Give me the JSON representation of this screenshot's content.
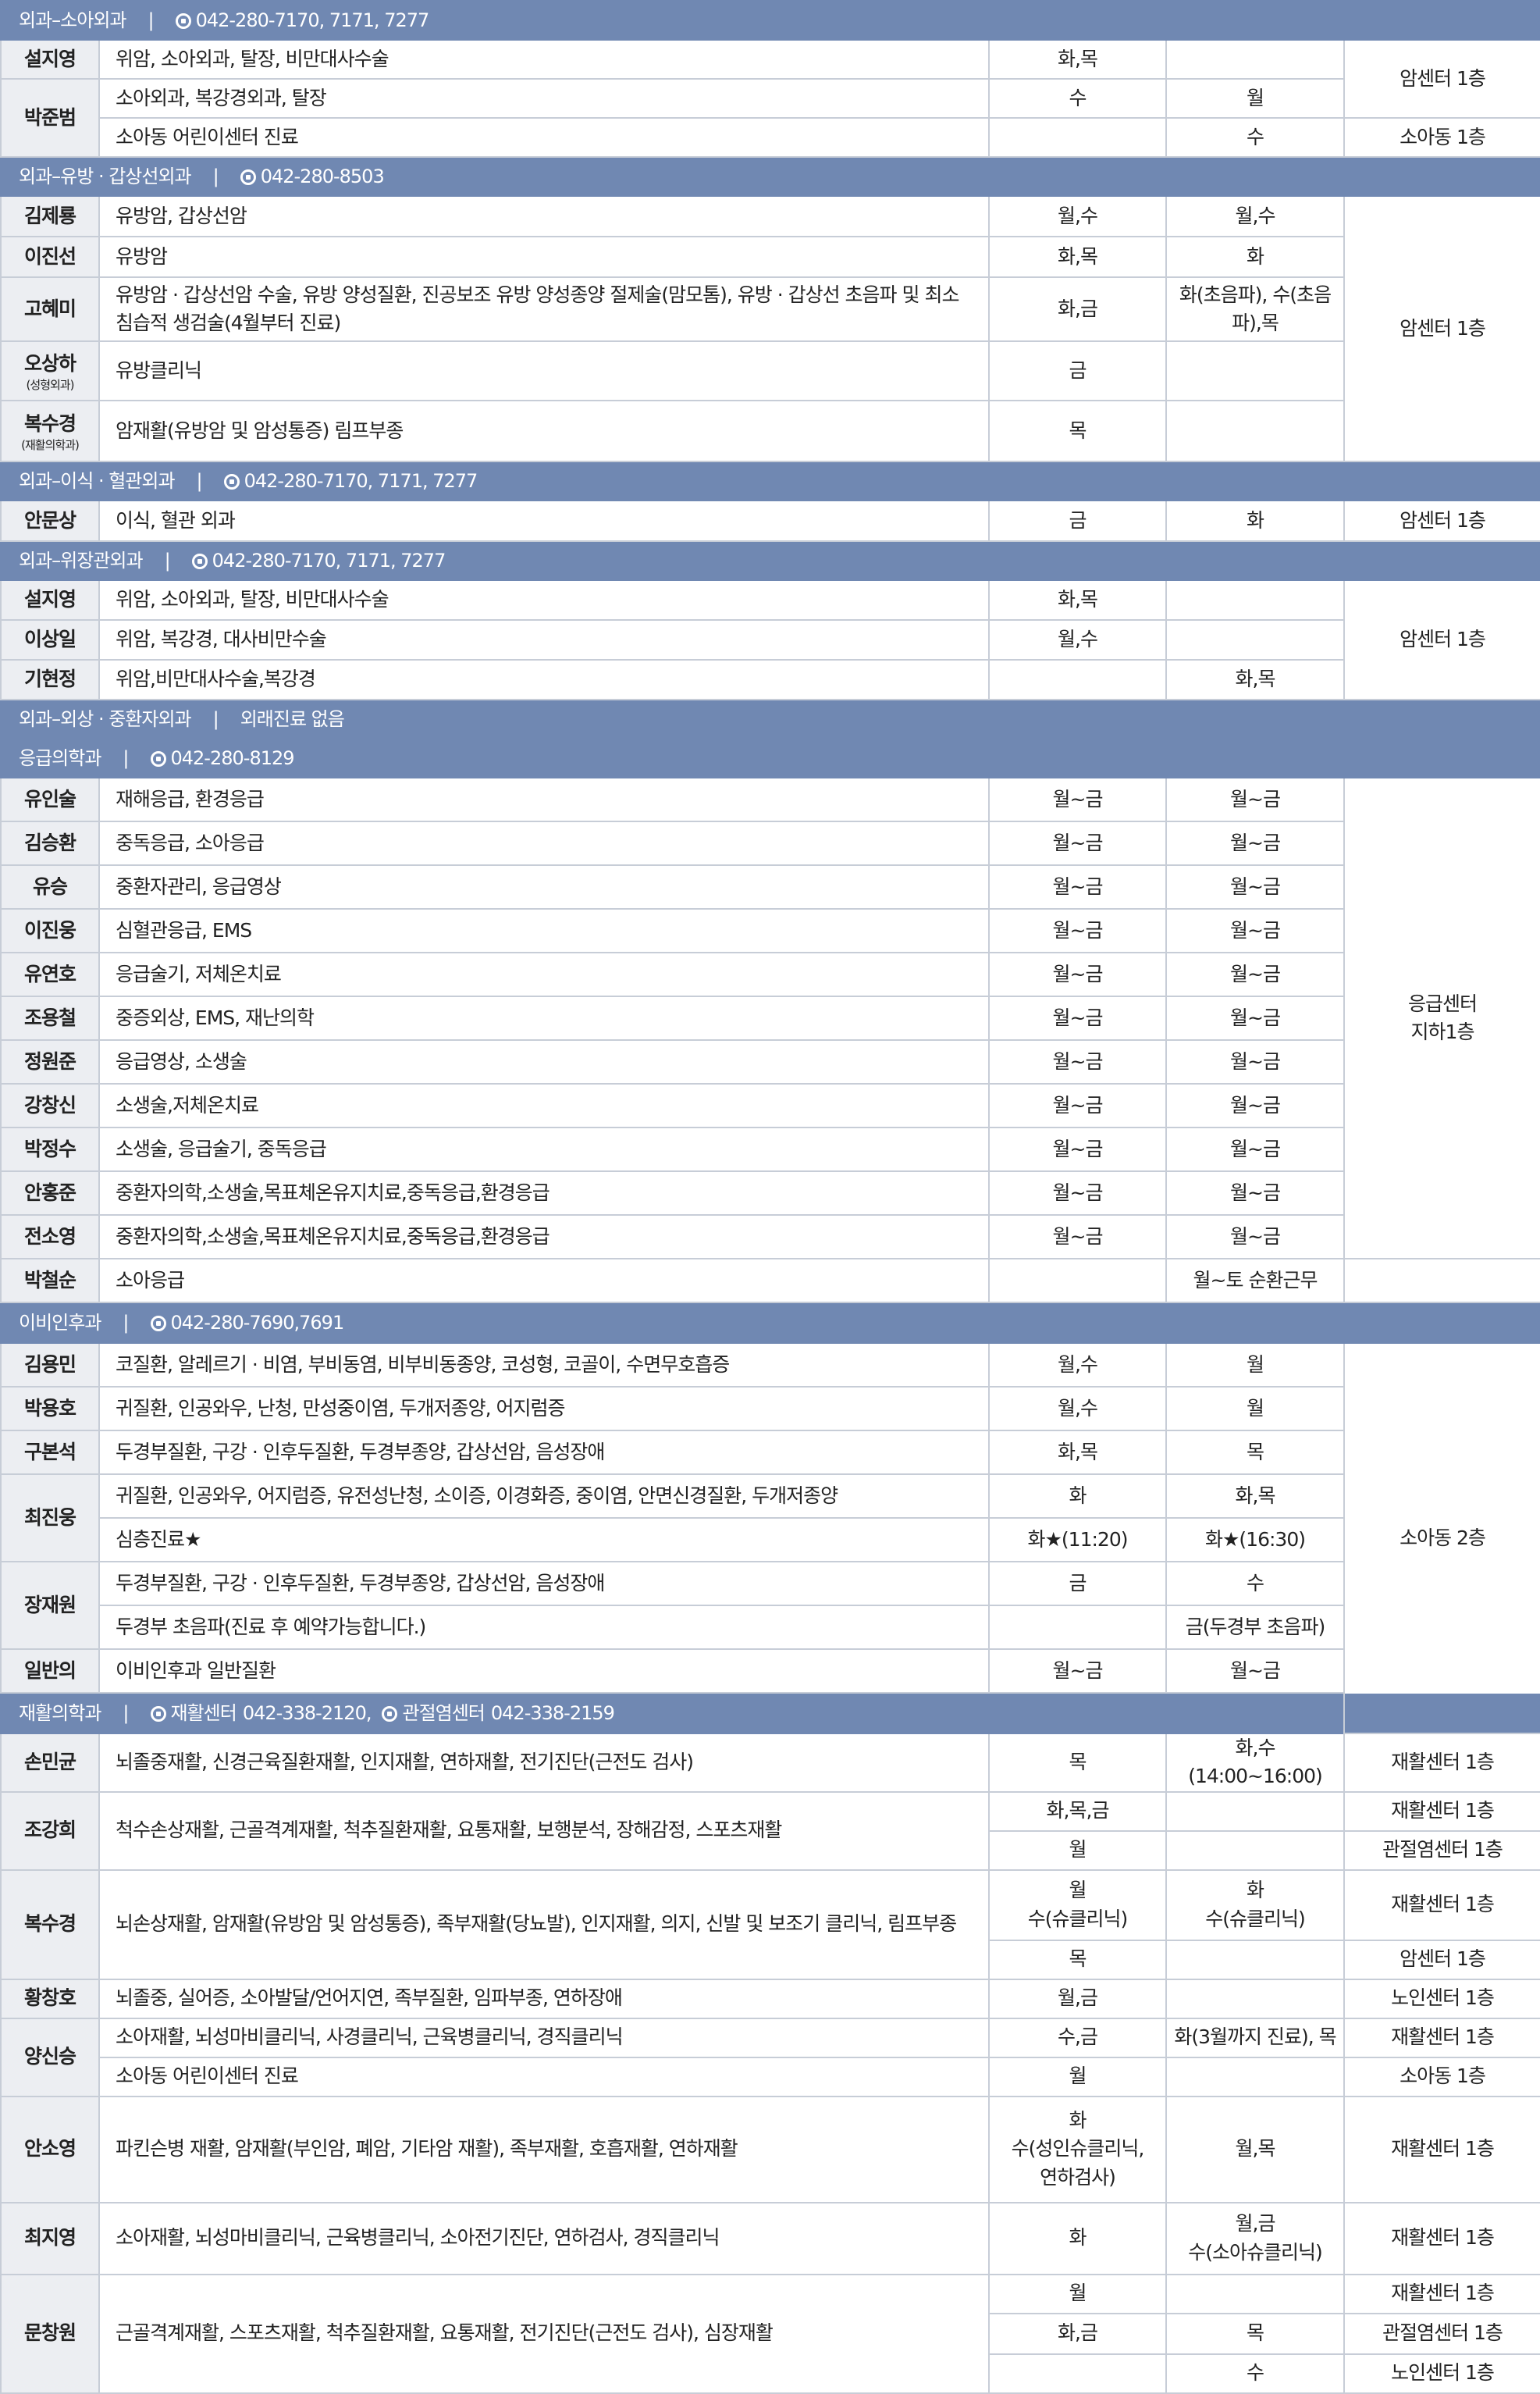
{
  "sections": [
    {
      "header": {
        "dept": "외과–소아외과",
        "contacts": [
          {
            "label": "",
            "phone": "042-280-7170, 7171, 7277"
          }
        ]
      },
      "rows": [
        [
          {
            "t": "nm",
            "v": "설지영",
            "h": 50
          },
          {
            "t": "desc",
            "v": "위암, 소아외과, 탈장, 비만대사수술"
          },
          {
            "t": "am",
            "v": "화,목"
          },
          {
            "t": "pm",
            "v": ""
          },
          {
            "t": "loc",
            "v": "암센터 1층",
            "rs": 2
          }
        ],
        [
          {
            "t": "nm",
            "v": "박준범",
            "rs": 2,
            "h": 50
          },
          {
            "t": "desc",
            "v": "소아외과, 복강경외과, 탈장"
          },
          {
            "t": "am",
            "v": "수"
          },
          {
            "t": "pm",
            "v": "월"
          }
        ],
        [
          {
            "t": "desc",
            "v": "소아동 어린이센터 진료",
            "h": 50
          },
          {
            "t": "am",
            "v": ""
          },
          {
            "t": "pm",
            "v": "수"
          },
          {
            "t": "loc",
            "v": "소아동 1층"
          }
        ]
      ]
    },
    {
      "header": {
        "dept": "외과–유방 · 갑상선외과",
        "contacts": [
          {
            "label": "",
            "phone": "042-280-8503"
          }
        ]
      },
      "rows": [
        [
          {
            "t": "nm",
            "v": "김제룡",
            "h": 52
          },
          {
            "t": "desc",
            "v": "유방암, 갑상선암"
          },
          {
            "t": "am",
            "v": "월,수"
          },
          {
            "t": "pm",
            "v": "월,수"
          },
          {
            "t": "loc",
            "v": "암센터 1층",
            "rs": 5
          }
        ],
        [
          {
            "t": "nm",
            "v": "이진선",
            "h": 52
          },
          {
            "t": "desc",
            "v": "유방암"
          },
          {
            "t": "am",
            "v": "화,목"
          },
          {
            "t": "pm",
            "v": "화"
          }
        ],
        [
          {
            "t": "nm",
            "v": "고혜미",
            "h": 82
          },
          {
            "t": "desc",
            "v": "유방암 · 갑상선암 수술, 유방 양성질환, 진공보조 유방 양성종양 절제술(맘모톰), 유방 · 갑상선 초음파 및 최소 침습적 생검술(4월부터 진료)"
          },
          {
            "t": "am",
            "v": "화,금"
          },
          {
            "t": "pm",
            "v": "화(초음파), 수(초음파),목"
          }
        ],
        [
          {
            "t": "nm",
            "v": "오상하",
            "sub": "(성형외과)",
            "h": 76
          },
          {
            "t": "desc",
            "v": "유방클리닉"
          },
          {
            "t": "am",
            "v": "금"
          },
          {
            "t": "pm",
            "v": ""
          }
        ],
        [
          {
            "t": "nm",
            "v": "복수경",
            "sub": "(재활의학과)",
            "h": 78
          },
          {
            "t": "desc",
            "v": "암재활(유방암 및 암성통증) 림프부종"
          },
          {
            "t": "am",
            "v": "목"
          },
          {
            "t": "pm",
            "v": ""
          }
        ]
      ]
    },
    {
      "header": {
        "dept": "외과–이식 · 혈관외과",
        "contacts": [
          {
            "label": "",
            "phone": "042-280-7170, 7171, 7277"
          }
        ]
      },
      "rows": [
        [
          {
            "t": "nm",
            "v": "안문상",
            "h": 52
          },
          {
            "t": "desc",
            "v": "이식, 혈관 외과"
          },
          {
            "t": "am",
            "v": "금"
          },
          {
            "t": "pm",
            "v": "화"
          },
          {
            "t": "loc",
            "v": "암센터 1층"
          }
        ]
      ]
    },
    {
      "header": {
        "dept": "외과–위장관외과",
        "contacts": [
          {
            "label": "",
            "phone": "042-280-7170, 7171, 7277"
          }
        ]
      },
      "rows": [
        [
          {
            "t": "nm",
            "v": "설지영",
            "h": 51
          },
          {
            "t": "desc",
            "v": "위암, 소아외과, 탈장, 비만대사수술"
          },
          {
            "t": "am",
            "v": "화,목"
          },
          {
            "t": "pm",
            "v": ""
          },
          {
            "t": "loc",
            "v": "암센터 1층",
            "rs": 3
          }
        ],
        [
          {
            "t": "nm",
            "v": "이상일",
            "h": 51
          },
          {
            "t": "desc",
            "v": "위암, 복강경, 대사비만수술"
          },
          {
            "t": "am",
            "v": "월,수"
          },
          {
            "t": "pm",
            "v": ""
          }
        ],
        [
          {
            "t": "nm",
            "v": "기현정",
            "h": 51
          },
          {
            "t": "desc",
            "v": "위암,비만대사수술,복강경"
          },
          {
            "t": "am",
            "v": ""
          },
          {
            "t": "pm",
            "v": "화,목"
          }
        ]
      ]
    },
    {
      "header": {
        "dept": "외과–외상 · 중환자외과",
        "contacts": [],
        "note": "외래진료 없음"
      },
      "rows": []
    },
    {
      "header": {
        "dept": "응급의학과",
        "contacts": [
          {
            "label": "",
            "phone": "042-280-8129"
          }
        ]
      },
      "rows": [
        [
          {
            "t": "nm",
            "v": "유인술",
            "h": 56
          },
          {
            "t": "desc",
            "v": "재해응급, 환경응급"
          },
          {
            "t": "am",
            "v": "월~금"
          },
          {
            "t": "pm",
            "v": "월~금"
          },
          {
            "t": "loc",
            "v": "응급센터\n지하1층",
            "rs": 11
          }
        ],
        [
          {
            "t": "nm",
            "v": "김승환",
            "h": 56
          },
          {
            "t": "desc",
            "v": "중독응급, 소아응급"
          },
          {
            "t": "am",
            "v": "월~금"
          },
          {
            "t": "pm",
            "v": "월~금"
          }
        ],
        [
          {
            "t": "nm",
            "v": "유승",
            "h": 56
          },
          {
            "t": "desc",
            "v": "중환자관리, 응급영상"
          },
          {
            "t": "am",
            "v": "월~금"
          },
          {
            "t": "pm",
            "v": "월~금"
          }
        ],
        [
          {
            "t": "nm",
            "v": "이진웅",
            "h": 56
          },
          {
            "t": "desc",
            "v": "심혈관응급, EMS"
          },
          {
            "t": "am",
            "v": "월~금"
          },
          {
            "t": "pm",
            "v": "월~금"
          }
        ],
        [
          {
            "t": "nm",
            "v": "유연호",
            "h": 56
          },
          {
            "t": "desc",
            "v": "응급술기, 저체온치료"
          },
          {
            "t": "am",
            "v": "월~금"
          },
          {
            "t": "pm",
            "v": "월~금"
          }
        ],
        [
          {
            "t": "nm",
            "v": "조용철",
            "h": 56
          },
          {
            "t": "desc",
            "v": "중증외상, EMS, 재난의학"
          },
          {
            "t": "am",
            "v": "월~금"
          },
          {
            "t": "pm",
            "v": "월~금"
          }
        ],
        [
          {
            "t": "nm",
            "v": "정원준",
            "h": 56
          },
          {
            "t": "desc",
            "v": "응급영상, 소생술"
          },
          {
            "t": "am",
            "v": "월~금"
          },
          {
            "t": "pm",
            "v": "월~금"
          }
        ],
        [
          {
            "t": "nm",
            "v": "강창신",
            "h": 56
          },
          {
            "t": "desc",
            "v": "소생술,저체온치료"
          },
          {
            "t": "am",
            "v": "월~금"
          },
          {
            "t": "pm",
            "v": "월~금"
          }
        ],
        [
          {
            "t": "nm",
            "v": "박정수",
            "h": 56
          },
          {
            "t": "desc",
            "v": "소생술, 응급술기, 중독응급"
          },
          {
            "t": "am",
            "v": "월~금"
          },
          {
            "t": "pm",
            "v": "월~금"
          }
        ],
        [
          {
            "t": "nm",
            "v": "안홍준",
            "h": 56
          },
          {
            "t": "desc",
            "v": "중환자의학,소생술,목표체온유지치료,중독응급,환경응급"
          },
          {
            "t": "am",
            "v": "월~금"
          },
          {
            "t": "pm",
            "v": "월~금"
          }
        ],
        [
          {
            "t": "nm",
            "v": "전소영",
            "h": 56
          },
          {
            "t": "desc",
            "v": "중환자의학,소생술,목표체온유지치료,중독응급,환경응급"
          },
          {
            "t": "am",
            "v": "월~금"
          },
          {
            "t": "pm",
            "v": "월~금"
          }
        ],
        [
          {
            "t": "nm",
            "v": "박철순",
            "h": 56
          },
          {
            "t": "desc",
            "v": "소아응급"
          },
          {
            "t": "am",
            "v": ""
          },
          {
            "t": "pm",
            "v": "월~토 순환근무"
          },
          {
            "t": "loc",
            "v": ""
          }
        ]
      ]
    },
    {
      "header": {
        "dept": "이비인후과",
        "contacts": [
          {
            "label": "",
            "phone": "042-280-7690,7691"
          }
        ]
      },
      "rows": [
        [
          {
            "t": "nm",
            "v": "김용민",
            "h": 56
          },
          {
            "t": "desc",
            "v": "코질환, 알레르기 · 비염, 부비동염, 비부비동종양, 코성형, 코골이, 수면무호흡증"
          },
          {
            "t": "am",
            "v": "월,수"
          },
          {
            "t": "pm",
            "v": "월"
          },
          {
            "t": "loc",
            "v": "소아동 2층",
            "rs": 9
          }
        ],
        [
          {
            "t": "nm",
            "v": "박용호",
            "h": 56
          },
          {
            "t": "desc",
            "v": "귀질환, 인공와우, 난청, 만성중이염, 두개저종양, 어지럼증"
          },
          {
            "t": "am",
            "v": "월,수"
          },
          {
            "t": "pm",
            "v": "월"
          }
        ],
        [
          {
            "t": "nm",
            "v": "구본석",
            "h": 56
          },
          {
            "t": "desc",
            "v": "두경부질환, 구강 · 인후두질환, 두경부종양, 갑상선암, 음성장애"
          },
          {
            "t": "am",
            "v": "화,목"
          },
          {
            "t": "pm",
            "v": "목"
          }
        ],
        [
          {
            "t": "nm",
            "v": "최진웅",
            "rs": 2,
            "h": 56
          },
          {
            "t": "desc",
            "v": "귀질환, 인공와우, 어지럼증, 유전성난청, 소이증, 이경화증, 중이염, 안면신경질환, 두개저종양"
          },
          {
            "t": "am",
            "v": "화"
          },
          {
            "t": "pm",
            "v": "화,목"
          }
        ],
        [
          {
            "t": "desc",
            "v": "심층진료★",
            "h": 56
          },
          {
            "t": "am",
            "v": "화★(11:20)"
          },
          {
            "t": "pm",
            "v": "화★(16:30)"
          }
        ],
        [
          {
            "t": "nm",
            "v": "장재원",
            "rs": 2,
            "h": 56
          },
          {
            "t": "desc",
            "v": "두경부질환, 구강 · 인후두질환, 두경부종양, 갑상선암, 음성장애"
          },
          {
            "t": "am",
            "v": "금"
          },
          {
            "t": "pm",
            "v": "수"
          }
        ],
        [
          {
            "t": "desc",
            "v": "두경부 초음파(진료 후 예약가능합니다.)",
            "h": 56
          },
          {
            "t": "am",
            "v": ""
          },
          {
            "t": "pm",
            "v": "금(두경부 초음파)"
          }
        ],
        [
          {
            "t": "nm",
            "v": "일반의",
            "h": 56
          },
          {
            "t": "desc",
            "v": "이비인후과 일반질환"
          },
          {
            "t": "am",
            "v": "월~금"
          },
          {
            "t": "pm",
            "v": "월~금"
          }
        ]
      ]
    },
    {
      "header": {
        "dept": "재활의학과",
        "contacts": [
          {
            "label": "재활센터",
            "phone": "042-338-2120,"
          },
          {
            "label": "관절염센터",
            "phone": "042-338-2159"
          }
        ]
      },
      "rows": [
        [
          {
            "t": "nm",
            "v": "손민균",
            "h": 52
          },
          {
            "t": "desc",
            "v": "뇌졸중재활, 신경근육질환재활, 인지재활, 연하재활, 전기진단(근전도 검사)"
          },
          {
            "t": "am",
            "v": "목"
          },
          {
            "t": "pm",
            "v": "화,수(14:00~16:00)"
          },
          {
            "t": "loc",
            "v": "재활센터 1층"
          }
        ],
        [
          {
            "t": "nm",
            "v": "조강희",
            "rs": 2,
            "h": 50
          },
          {
            "t": "desc",
            "v": "척수손상재활, 근골격계재활, 척추질환재활, 요통재활, 보행분석, 장해감정, 스포츠재활",
            "rs": 2
          },
          {
            "t": "am",
            "v": "화,목,금"
          },
          {
            "t": "pm",
            "v": ""
          },
          {
            "t": "loc",
            "v": "재활센터 1층"
          }
        ],
        [
          {
            "h": 50
          },
          {
            "t": "am",
            "v": "월"
          },
          {
            "t": "pm",
            "v": ""
          },
          {
            "t": "loc",
            "v": "관절염센터 1층"
          }
        ],
        [
          {
            "t": "nm",
            "v": "복수경",
            "rs": 2,
            "h": 90
          },
          {
            "t": "desc",
            "v": "뇌손상재활, 암재활(유방암 및 암성통증), 족부재활(당뇨발), 인지재활, 의지, 신발 및 보조기 클리닉, 림프부종",
            "rs": 2
          },
          {
            "t": "am",
            "v": "월\n수(슈클리닉)"
          },
          {
            "t": "pm",
            "v": "화\n수(슈클리닉)"
          },
          {
            "t": "loc",
            "v": "재활센터 1층"
          }
        ],
        [
          {
            "h": 50
          },
          {
            "t": "am",
            "v": "목"
          },
          {
            "t": "pm",
            "v": ""
          },
          {
            "t": "loc",
            "v": "암센터 1층"
          }
        ],
        [
          {
            "t": "nm",
            "v": "황창호",
            "h": 50
          },
          {
            "t": "desc",
            "v": "뇌졸중, 실어증, 소아발달/언어지연, 족부질환, 임파부종, 연하장애"
          },
          {
            "t": "am",
            "v": "월,금"
          },
          {
            "t": "pm",
            "v": ""
          },
          {
            "t": "loc",
            "v": "노인센터 1층"
          }
        ],
        [
          {
            "t": "nm",
            "v": "양신승",
            "rs": 2,
            "h": 50
          },
          {
            "t": "desc",
            "v": "소아재활, 뇌성마비클리닉, 사경클리닉, 근육병클리닉, 경직클리닉"
          },
          {
            "t": "am",
            "v": "수,금"
          },
          {
            "t": "pm",
            "v": "화(3월까지 진료), 목"
          },
          {
            "t": "loc",
            "v": "재활센터 1층"
          }
        ],
        [
          {
            "t": "desc",
            "v": "소아동 어린이센터 진료",
            "h": 50
          },
          {
            "t": "am",
            "v": "월"
          },
          {
            "t": "pm",
            "v": ""
          },
          {
            "t": "loc",
            "v": "소아동 1층"
          }
        ],
        [
          {
            "t": "nm",
            "v": "안소영",
            "h": 136
          },
          {
            "t": "desc",
            "v": "파킨슨병 재활, 암재활(부인암, 폐암, 기타암 재활), 족부재활, 호흡재활, 연하재활"
          },
          {
            "t": "am",
            "v": "화\n수(성인슈클리닉,\n연하검사)"
          },
          {
            "t": "pm",
            "v": "월,목"
          },
          {
            "t": "loc",
            "v": "재활센터 1층"
          }
        ],
        [
          {
            "t": "nm",
            "v": "최지영",
            "h": 92
          },
          {
            "t": "desc",
            "v": "소아재활, 뇌성마비클리닉, 근육병클리닉, 소아전기진단, 연하검사, 경직클리닉"
          },
          {
            "t": "am",
            "v": "화"
          },
          {
            "t": "pm",
            "v": "월,금\n수(소아슈클리닉)"
          },
          {
            "t": "loc",
            "v": "재활센터 1층"
          }
        ],
        [
          {
            "t": "nm",
            "v": "문창원",
            "rs": 3,
            "h": 50
          },
          {
            "t": "desc",
            "v": "근골격계재활, 스포츠재활, 척추질환재활, 요통재활, 전기진단(근전도 검사), 심장재활",
            "rs": 3
          },
          {
            "t": "am",
            "v": "월"
          },
          {
            "t": "pm",
            "v": ""
          },
          {
            "t": "loc",
            "v": "재활센터 1층"
          }
        ],
        [
          {
            "h": 52
          },
          {
            "t": "am",
            "v": "화,금"
          },
          {
            "t": "pm",
            "v": "목"
          },
          {
            "t": "loc",
            "v": "관절염센터 1층"
          }
        ],
        [
          {
            "h": 50
          },
          {
            "t": "am",
            "v": ""
          },
          {
            "t": "pm",
            "v": "수"
          },
          {
            "t": "loc",
            "v": "노인센터 1층"
          }
        ]
      ]
    }
  ]
}
